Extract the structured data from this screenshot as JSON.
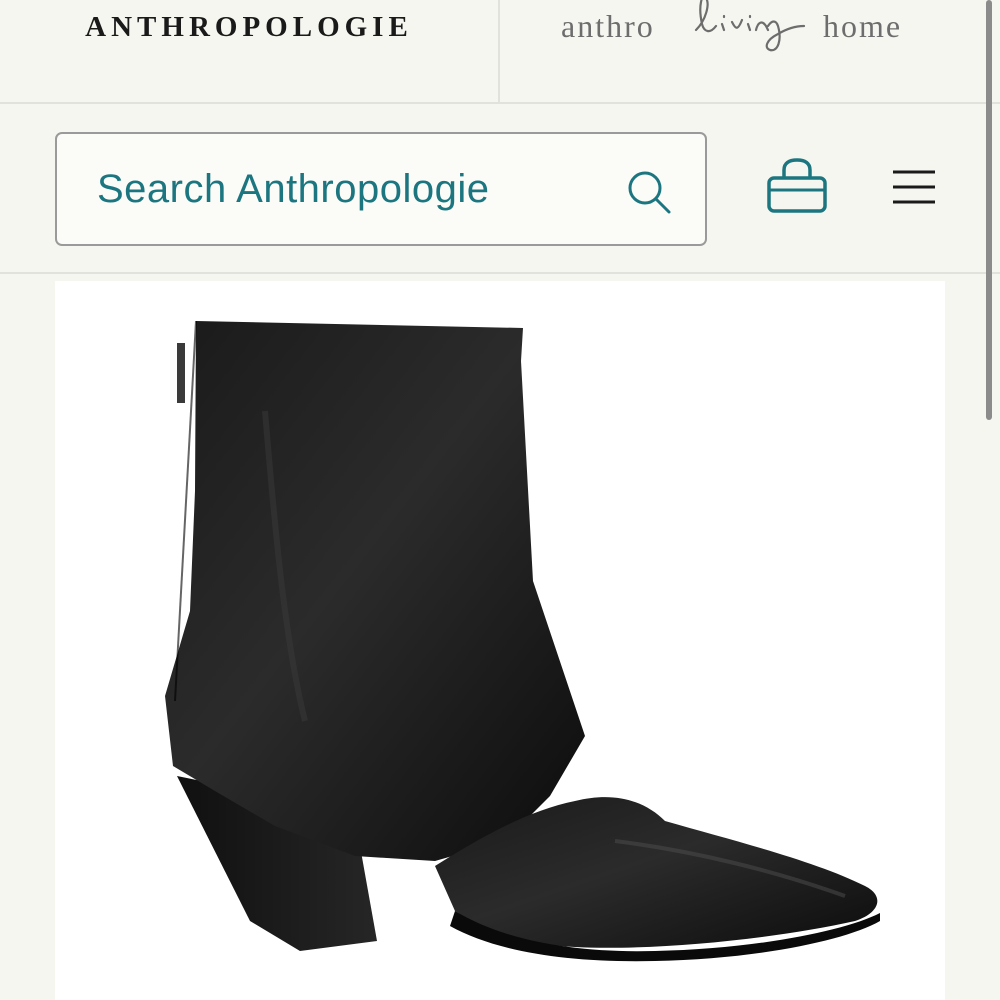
{
  "header": {
    "brand_logo": "ANTHROPOLOGIE",
    "living_logo": {
      "left": "anthro",
      "script": "living",
      "right": "home"
    }
  },
  "search": {
    "placeholder": "Search Anthropologie"
  },
  "icons": {
    "search": "search-icon",
    "bag": "shopping-bag-icon",
    "menu": "hamburger-menu-icon"
  },
  "colors": {
    "accent": "#1c7680",
    "background": "#f6f6f1",
    "border": "#9a9a9a",
    "logo_text": "#1a1a1a"
  }
}
